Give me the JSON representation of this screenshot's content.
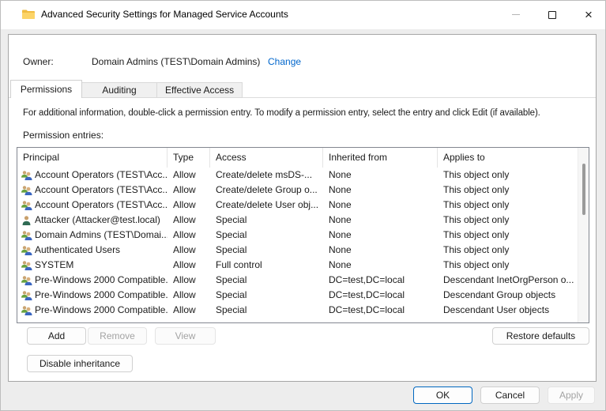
{
  "window": {
    "title": "Advanced Security Settings for Managed Service Accounts"
  },
  "owner": {
    "label": "Owner:",
    "value": "Domain Admins (TEST\\Domain Admins)",
    "change_link": "Change"
  },
  "tabs": [
    {
      "label": "Permissions",
      "active": true
    },
    {
      "label": "Auditing",
      "active": false
    },
    {
      "label": "Effective Access",
      "active": false
    }
  ],
  "instructions": "For additional information, double-click a permission entry. To modify a permission entry, select the entry and click Edit (if available).",
  "entries_label": "Permission entries:",
  "table": {
    "columns": [
      "Principal",
      "Type",
      "Access",
      "Inherited from",
      "Applies to"
    ],
    "rows": [
      {
        "icon": "group",
        "principal": "Account Operators (TEST\\Acc...",
        "type": "Allow",
        "access": "Create/delete msDS-...",
        "inherited_from": "None",
        "applies_to": "This object only"
      },
      {
        "icon": "group",
        "principal": "Account Operators (TEST\\Acc...",
        "type": "Allow",
        "access": "Create/delete Group o...",
        "inherited_from": "None",
        "applies_to": "This object only"
      },
      {
        "icon": "group",
        "principal": "Account Operators (TEST\\Acc...",
        "type": "Allow",
        "access": "Create/delete User obj...",
        "inherited_from": "None",
        "applies_to": "This object only"
      },
      {
        "icon": "user",
        "principal": "Attacker (Attacker@test.local)",
        "type": "Allow",
        "access": "Special",
        "inherited_from": "None",
        "applies_to": "This object only"
      },
      {
        "icon": "group",
        "principal": "Domain Admins (TEST\\Domai...",
        "type": "Allow",
        "access": "Special",
        "inherited_from": "None",
        "applies_to": "This object only"
      },
      {
        "icon": "group",
        "principal": "Authenticated Users",
        "type": "Allow",
        "access": "Special",
        "inherited_from": "None",
        "applies_to": "This object only"
      },
      {
        "icon": "group",
        "principal": "SYSTEM",
        "type": "Allow",
        "access": "Full control",
        "inherited_from": "None",
        "applies_to": "This object only"
      },
      {
        "icon": "group",
        "principal": "Pre-Windows 2000 Compatible...",
        "type": "Allow",
        "access": "Special",
        "inherited_from": "DC=test,DC=local",
        "applies_to": "Descendant InetOrgPerson o..."
      },
      {
        "icon": "group",
        "principal": "Pre-Windows 2000 Compatible...",
        "type": "Allow",
        "access": "Special",
        "inherited_from": "DC=test,DC=local",
        "applies_to": "Descendant Group objects"
      },
      {
        "icon": "group",
        "principal": "Pre-Windows 2000 Compatible...",
        "type": "Allow",
        "access": "Special",
        "inherited_from": "DC=test,DC=local",
        "applies_to": "Descendant User objects"
      }
    ]
  },
  "buttons": {
    "add": "Add",
    "remove": "Remove",
    "view": "View",
    "restore_defaults": "Restore defaults",
    "disable_inheritance": "Disable inheritance",
    "ok": "OK",
    "cancel": "Cancel",
    "apply": "Apply"
  },
  "colors": {
    "accent": "#0067c0",
    "link": "#0066cc",
    "disabled_text": "#a3a3a3"
  }
}
